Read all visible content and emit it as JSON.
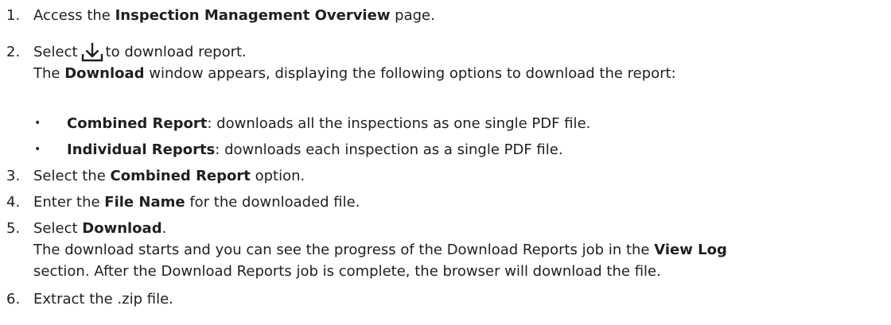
{
  "steps": [
    {
      "num": "1.",
      "pre": "Access the ",
      "bold": "Inspection Management Overview",
      "post": " page."
    },
    {
      "num": "2.",
      "pre": "Select",
      "icon": "download-icon",
      "post": "to download report.",
      "result_pre": "The ",
      "result_bold": "Download",
      "result_post": " window appears, displaying the following options to download the report:",
      "options": [
        {
          "bold": "Combined Report",
          "text": ": downloads all the inspections as one single PDF file."
        },
        {
          "bold": "Individual Reports",
          "text": ": downloads each inspection as a single PDF file."
        }
      ]
    },
    {
      "num": "3.",
      "pre": "Select the ",
      "bold": "Combined Report",
      "post": " option."
    },
    {
      "num": "4.",
      "pre": "Enter the ",
      "bold": "File Name",
      "post": " for the downloaded file."
    },
    {
      "num": "5.",
      "pre": "Select ",
      "bold": "Download",
      "post": ".",
      "result1_pre": "The download starts and you can see the progress of the Download Reports job in the ",
      "result1_bold": "View Log",
      "result2": "section. After the Download Reports job is complete, the browser will download the file."
    },
    {
      "num": "6.",
      "pre": "Extract the .zip file."
    }
  ],
  "bullet_char": "•",
  "colors": {
    "text": "#1f1f1f",
    "background": "#ffffff"
  }
}
